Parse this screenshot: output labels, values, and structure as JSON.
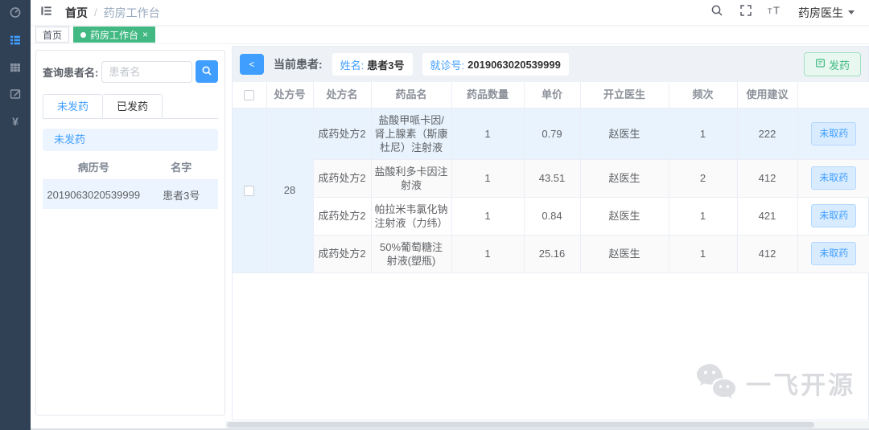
{
  "navbar": {
    "breadcrumb": {
      "home": "首页",
      "separator": "/",
      "current": "药房工作台"
    },
    "user": {
      "name": "药房医生"
    }
  },
  "tags_view": {
    "tabs": [
      {
        "label": "首页",
        "active": false
      },
      {
        "label": "药房工作台",
        "active": true
      }
    ],
    "close_icon": "×"
  },
  "sidebar": {
    "items": [
      {
        "icon": "dashboard-icon",
        "active": false
      },
      {
        "icon": "list-icon",
        "active": true
      },
      {
        "icon": "table-icon",
        "active": false
      },
      {
        "icon": "form-icon",
        "active": false
      },
      {
        "icon": "money-icon",
        "active": false
      }
    ],
    "money_glyph": "¥"
  },
  "left_panel": {
    "search_label": "查询患者名:",
    "search_placeholder": "患者名",
    "tabs": [
      {
        "label": "未发药",
        "active": true
      },
      {
        "label": "已发药",
        "active": false
      }
    ],
    "alert_text": "未发药",
    "patient_table": {
      "headers": [
        "病历号",
        "名字"
      ],
      "rows": [
        {
          "record_no": "2019063020539999",
          "name": "患者3号",
          "selected": true
        }
      ]
    }
  },
  "main": {
    "toolbar": {
      "back_label": "<",
      "current_patient_label": "当前患者:",
      "name_label": "姓名:",
      "name_value": "患者3号",
      "visit_label": "就诊号:",
      "visit_value": "2019063020539999",
      "dispense_label": "发药"
    },
    "table": {
      "headers": [
        "处方号",
        "处方名",
        "药品名",
        "药品数量",
        "单价",
        "开立医生",
        "频次",
        "使用建议"
      ],
      "prescription_no": "28",
      "rows": [
        {
          "prescription_name": "成药处方2",
          "drug_name": "盐酸甲哌卡因/肾上腺素（斯康杜尼）注射液",
          "quantity": "1",
          "unit_price": "0.79",
          "doctor": "赵医生",
          "frequency": "1",
          "usage_advice": "222",
          "status": "未取药"
        },
        {
          "prescription_name": "成药处方2",
          "drug_name": "盐酸利多卡因注射液",
          "quantity": "1",
          "unit_price": "43.51",
          "doctor": "赵医生",
          "frequency": "2",
          "usage_advice": "412",
          "status": "未取药"
        },
        {
          "prescription_name": "成药处方2",
          "drug_name": "帕拉米韦氯化钠注射液（力纬）",
          "quantity": "1",
          "unit_price": "0.84",
          "doctor": "赵医生",
          "frequency": "1",
          "usage_advice": "421",
          "status": "未取药"
        },
        {
          "prescription_name": "成药处方2",
          "drug_name": "50%葡萄糖注射液(塑瓶)",
          "quantity": "1",
          "unit_price": "25.16",
          "doctor": "赵医生",
          "frequency": "1",
          "usage_advice": "412",
          "status": "未取药"
        }
      ]
    }
  },
  "watermark": {
    "text": "一飞开源"
  },
  "colors": {
    "sidebar_bg": "#304156",
    "accent_blue": "#409eff",
    "active_green": "#42b983",
    "row_highlight": "#e8f3fd",
    "light_blue": "#ecf5ff",
    "toolbar_bg": "#eef1f6"
  }
}
